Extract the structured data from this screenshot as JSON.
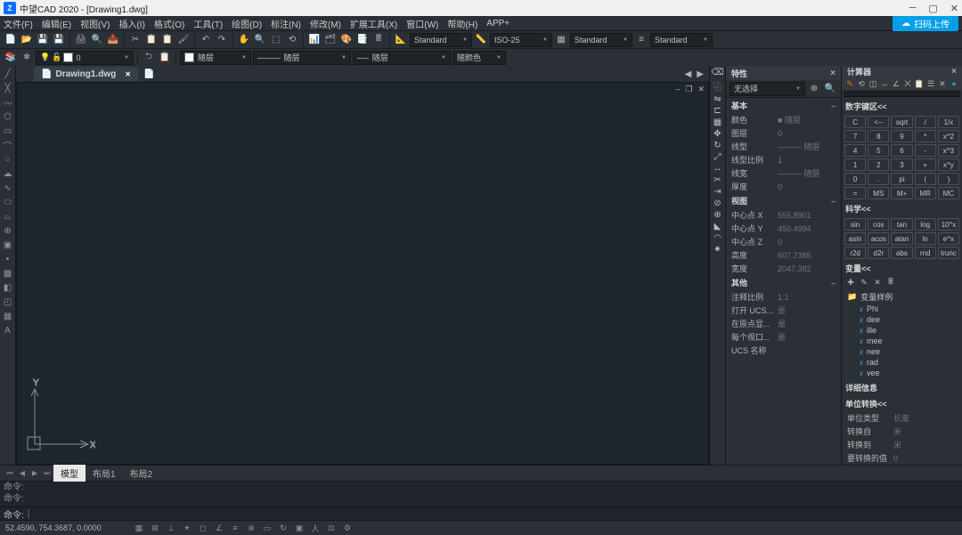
{
  "title": "中望CAD 2020 - [Drawing1.dwg]",
  "titleIcon": "Z",
  "upload": "扫码上传",
  "menu": [
    "文件(F)",
    "编辑(E)",
    "视图(V)",
    "插入(I)",
    "格式(O)",
    "工具(T)",
    "绘图(D)",
    "标注(N)",
    "修改(M)",
    "扩展工具(X)",
    "窗口(W)",
    "帮助(H)",
    "APP+"
  ],
  "toolbar1": {
    "layer": "0",
    "std1": "Standard",
    "std2": "ISO-25",
    "std3": "Standard",
    "std4": "Standard"
  },
  "toolbar2": {
    "color": "随层",
    "ltype": "随层",
    "lweight": "随层",
    "plotstyle": "随颜色"
  },
  "fileTab": "Drawing1.dwg",
  "props": {
    "title": "特性",
    "sel": "无选择",
    "sections": {
      "basic": {
        "h": "基本",
        "rows": [
          [
            "颜色",
            "■ 随层"
          ],
          [
            "图层",
            "0"
          ],
          [
            "线型",
            "——— 随层"
          ],
          [
            "线型比例",
            "1"
          ],
          [
            "线宽",
            "——— 随层"
          ],
          [
            "厚度",
            "0"
          ]
        ]
      },
      "view": {
        "h": "视图",
        "rows": [
          [
            "中心点 X",
            "555.8901"
          ],
          [
            "中心点 Y",
            "450.4994"
          ],
          [
            "中心点 Z",
            "0"
          ],
          [
            "高度",
            "607.7385"
          ],
          [
            "宽度",
            "2047.382"
          ]
        ]
      },
      "misc": {
        "h": "其他",
        "rows": [
          [
            "注释比例",
            "1:1"
          ],
          [
            "打开 UCS...",
            "是"
          ],
          [
            "在原点显...",
            "是"
          ],
          [
            "每个视口...",
            "是"
          ],
          [
            "UCS 名称",
            ""
          ]
        ]
      }
    }
  },
  "calc": {
    "title": "计算器",
    "numpad_h": "数字键区<<",
    "keys": [
      "C",
      "<--",
      "sqrt",
      "/",
      "1/x",
      "7",
      "8",
      "9",
      "*",
      "x^2",
      "4",
      "5",
      "6",
      "-",
      "x^3",
      "1",
      "2",
      "3",
      "+",
      "x^y",
      "0",
      ".",
      "pi",
      "(",
      ")",
      "=",
      "MS",
      "M+",
      "MR",
      "MC"
    ],
    "sci_h": "科学<<",
    "sci": [
      "sin",
      "cos",
      "tan",
      "log",
      "10^x",
      "asin",
      "acos",
      "atan",
      "ln",
      "e^x",
      "r2d",
      "d2r",
      "abs",
      "rnd",
      "trunc"
    ],
    "var_h": "变量<<",
    "var_group": "变量样例",
    "vars": [
      "Phi",
      "dee",
      "ille",
      "mee",
      "nee",
      "rad",
      "vee"
    ],
    "detail_h": "详细信息",
    "unit_h": "单位转换<<",
    "unit_rows": [
      [
        "单位类型",
        "长度"
      ],
      [
        "转换自",
        "米"
      ],
      [
        "转换到",
        "米"
      ],
      [
        "要转换的值",
        "0"
      ]
    ]
  },
  "layoutTabs": [
    "模型",
    "布局1",
    "布局2"
  ],
  "cmd": {
    "hist": [
      "命令:",
      "命令:"
    ],
    "prompt": "命令:",
    "cursor": "|"
  },
  "status": {
    "coords": "52.4590, 754.3687, 0.0000"
  }
}
